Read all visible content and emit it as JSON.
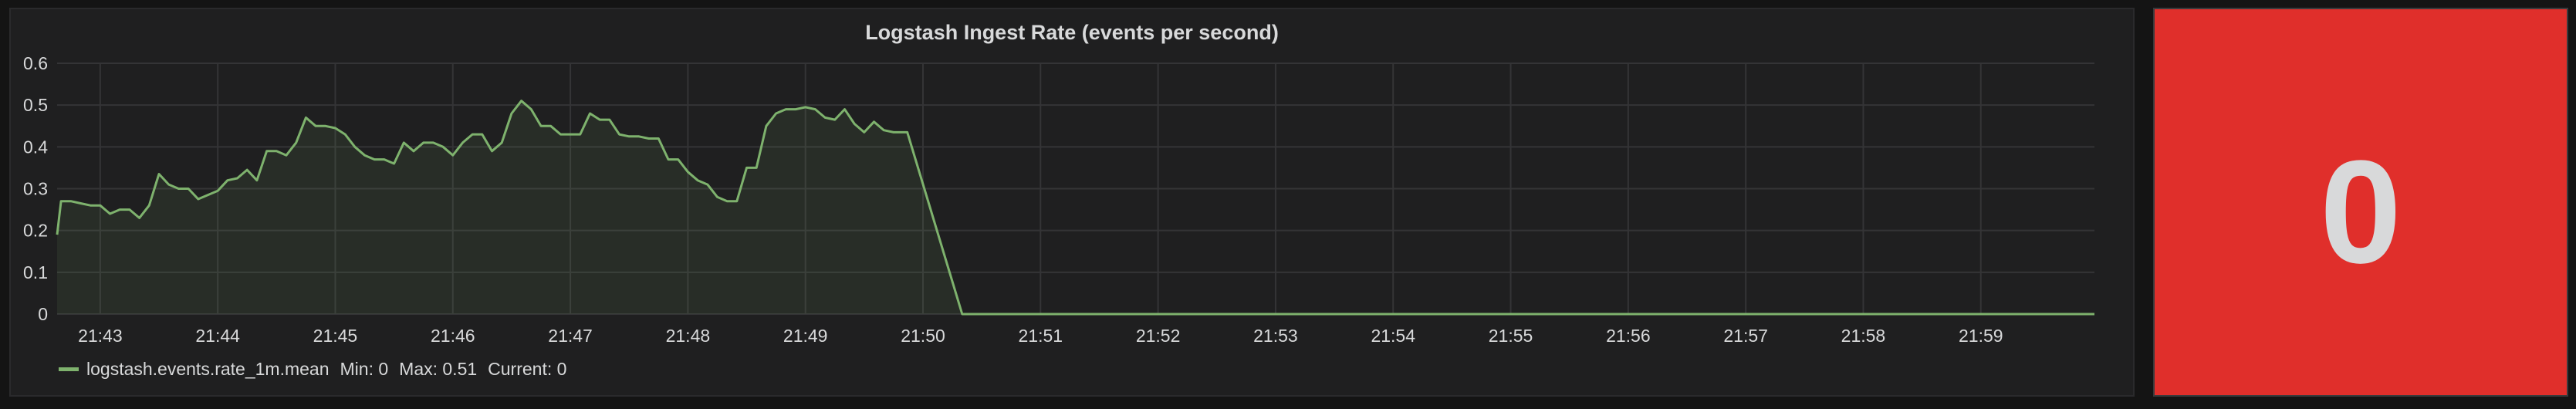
{
  "graph_panel": {
    "title": "Logstash Ingest Rate (events per second)",
    "legend": {
      "series_name": "logstash.events.rate_1m.mean",
      "min": "Min: 0",
      "max": "Max: 0.51",
      "current": "Current: 0"
    }
  },
  "stat_panel": {
    "value": "0",
    "background_color": "#e02f2b"
  },
  "colors": {
    "series_line": "#7eb26d",
    "grid": "#343436",
    "axis_text": "#d8d9da"
  },
  "chart_data": {
    "type": "area",
    "title": "Logstash Ingest Rate (events per second)",
    "xlabel": "",
    "ylabel": "",
    "x_range": [
      "21:42:38",
      "21:59:58"
    ],
    "x_ticks": [
      "21:43",
      "21:44",
      "21:45",
      "21:46",
      "21:47",
      "21:48",
      "21:49",
      "21:50",
      "21:51",
      "21:52",
      "21:53",
      "21:54",
      "21:55",
      "21:56",
      "21:57",
      "21:58",
      "21:59"
    ],
    "y_ticks": [
      "0",
      "0.1",
      "0.2",
      "0.3",
      "0.4",
      "0.5",
      "0.6"
    ],
    "ylim": [
      0,
      0.6
    ],
    "grid": true,
    "legend_position": "bottom-left",
    "series": [
      {
        "name": "logstash.events.rate_1m.mean",
        "color": "#7eb26d",
        "points": [
          [
            "21:42:38",
            0.19
          ],
          [
            "21:42:40",
            0.27
          ],
          [
            "21:42:45",
            0.27
          ],
          [
            "21:42:50",
            0.265
          ],
          [
            "21:42:55",
            0.26
          ],
          [
            "21:43:00",
            0.26
          ],
          [
            "21:43:05",
            0.24
          ],
          [
            "21:43:10",
            0.25
          ],
          [
            "21:43:15",
            0.25
          ],
          [
            "21:43:20",
            0.23
          ],
          [
            "21:43:25",
            0.26
          ],
          [
            "21:43:30",
            0.335
          ],
          [
            "21:43:35",
            0.31
          ],
          [
            "21:43:40",
            0.3
          ],
          [
            "21:43:45",
            0.3
          ],
          [
            "21:43:50",
            0.275
          ],
          [
            "21:43:55",
            0.285
          ],
          [
            "21:44:00",
            0.295
          ],
          [
            "21:44:05",
            0.32
          ],
          [
            "21:44:10",
            0.325
          ],
          [
            "21:44:15",
            0.345
          ],
          [
            "21:44:20",
            0.32
          ],
          [
            "21:44:25",
            0.39
          ],
          [
            "21:44:30",
            0.39
          ],
          [
            "21:44:35",
            0.38
          ],
          [
            "21:44:40",
            0.41
          ],
          [
            "21:44:45",
            0.47
          ],
          [
            "21:44:50",
            0.45
          ],
          [
            "21:44:55",
            0.45
          ],
          [
            "21:45:00",
            0.445
          ],
          [
            "21:45:05",
            0.43
          ],
          [
            "21:45:10",
            0.4
          ],
          [
            "21:45:15",
            0.38
          ],
          [
            "21:45:20",
            0.37
          ],
          [
            "21:45:25",
            0.37
          ],
          [
            "21:45:30",
            0.36
          ],
          [
            "21:45:35",
            0.41
          ],
          [
            "21:45:40",
            0.39
          ],
          [
            "21:45:45",
            0.41
          ],
          [
            "21:45:50",
            0.41
          ],
          [
            "21:45:55",
            0.4
          ],
          [
            "21:46:00",
            0.38
          ],
          [
            "21:46:05",
            0.41
          ],
          [
            "21:46:10",
            0.43
          ],
          [
            "21:46:15",
            0.43
          ],
          [
            "21:46:20",
            0.39
          ],
          [
            "21:46:25",
            0.41
          ],
          [
            "21:46:30",
            0.48
          ],
          [
            "21:46:35",
            0.51
          ],
          [
            "21:46:40",
            0.49
          ],
          [
            "21:46:45",
            0.45
          ],
          [
            "21:46:50",
            0.45
          ],
          [
            "21:46:55",
            0.43
          ],
          [
            "21:47:00",
            0.43
          ],
          [
            "21:47:05",
            0.43
          ],
          [
            "21:47:10",
            0.48
          ],
          [
            "21:47:15",
            0.465
          ],
          [
            "21:47:20",
            0.465
          ],
          [
            "21:47:25",
            0.43
          ],
          [
            "21:47:30",
            0.425
          ],
          [
            "21:47:35",
            0.425
          ],
          [
            "21:47:40",
            0.42
          ],
          [
            "21:47:45",
            0.42
          ],
          [
            "21:47:50",
            0.37
          ],
          [
            "21:47:55",
            0.37
          ],
          [
            "21:48:00",
            0.34
          ],
          [
            "21:48:05",
            0.32
          ],
          [
            "21:48:10",
            0.31
          ],
          [
            "21:48:15",
            0.28
          ],
          [
            "21:48:20",
            0.27
          ],
          [
            "21:48:25",
            0.27
          ],
          [
            "21:48:30",
            0.35
          ],
          [
            "21:48:35",
            0.35
          ],
          [
            "21:48:40",
            0.45
          ],
          [
            "21:48:45",
            0.48
          ],
          [
            "21:48:50",
            0.49
          ],
          [
            "21:48:55",
            0.49
          ],
          [
            "21:49:00",
            0.495
          ],
          [
            "21:49:05",
            0.49
          ],
          [
            "21:49:10",
            0.47
          ],
          [
            "21:49:15",
            0.465
          ],
          [
            "21:49:20",
            0.49
          ],
          [
            "21:49:25",
            0.455
          ],
          [
            "21:49:30",
            0.435
          ],
          [
            "21:49:35",
            0.46
          ],
          [
            "21:49:40",
            0.44
          ],
          [
            "21:49:45",
            0.435
          ],
          [
            "21:49:50",
            0.435
          ],
          [
            "21:49:52",
            0.435
          ],
          [
            "21:50:20",
            0.0
          ],
          [
            "21:51:00",
            0.0
          ],
          [
            "21:52:00",
            0.0
          ],
          [
            "21:53:00",
            0.0
          ],
          [
            "21:54:00",
            0.0
          ],
          [
            "21:55:00",
            0.0
          ],
          [
            "21:56:00",
            0.0
          ],
          [
            "21:57:00",
            0.0
          ],
          [
            "21:58:00",
            0.0
          ],
          [
            "21:59:00",
            0.0
          ],
          [
            "21:59:58",
            0.0
          ]
        ]
      }
    ]
  }
}
